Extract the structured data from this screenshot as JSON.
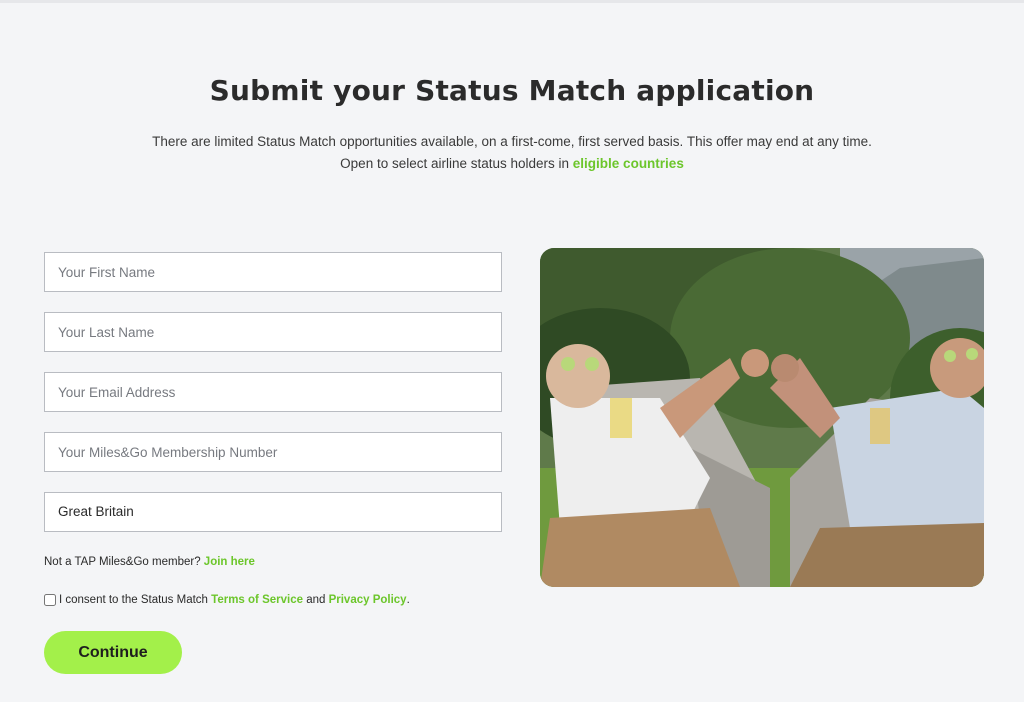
{
  "header": {
    "title": "Submit your Status Match application",
    "intro_line1": "There are limited Status Match opportunities available, on a first-come, first served basis. This offer may end at any time.",
    "intro_line2_prefix": "Open to select airline status holders in ",
    "intro_link": "eligible countries"
  },
  "form": {
    "first_name_placeholder": "Your First Name",
    "last_name_placeholder": "Your Last Name",
    "email_placeholder": "Your Email Address",
    "membership_placeholder": "Your Miles&Go Membership Number",
    "country_value": "Great Britain",
    "member_note_prefix": "Not a TAP Miles&Go member? ",
    "join_link": "Join here",
    "consent_prefix": "I consent to the Status Match ",
    "terms_link": "Terms of Service",
    "consent_and": " and ",
    "privacy_link": "Privacy Policy",
    "consent_suffix": ".",
    "continue_label": "Continue"
  },
  "colors": {
    "accent_green": "#6cc62b",
    "button_green": "#a3f04a",
    "background": "#f4f5f7"
  }
}
